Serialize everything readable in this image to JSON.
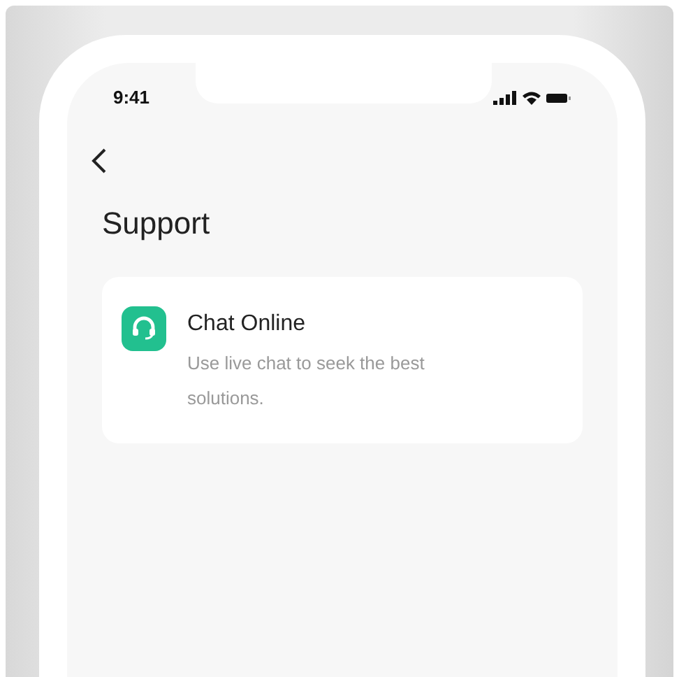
{
  "status_bar": {
    "time": "9:41"
  },
  "page": {
    "title": "Support"
  },
  "options": [
    {
      "kind": "chat",
      "title": "Chat Online",
      "description": "Use live chat to seek the best solutions."
    }
  ]
}
